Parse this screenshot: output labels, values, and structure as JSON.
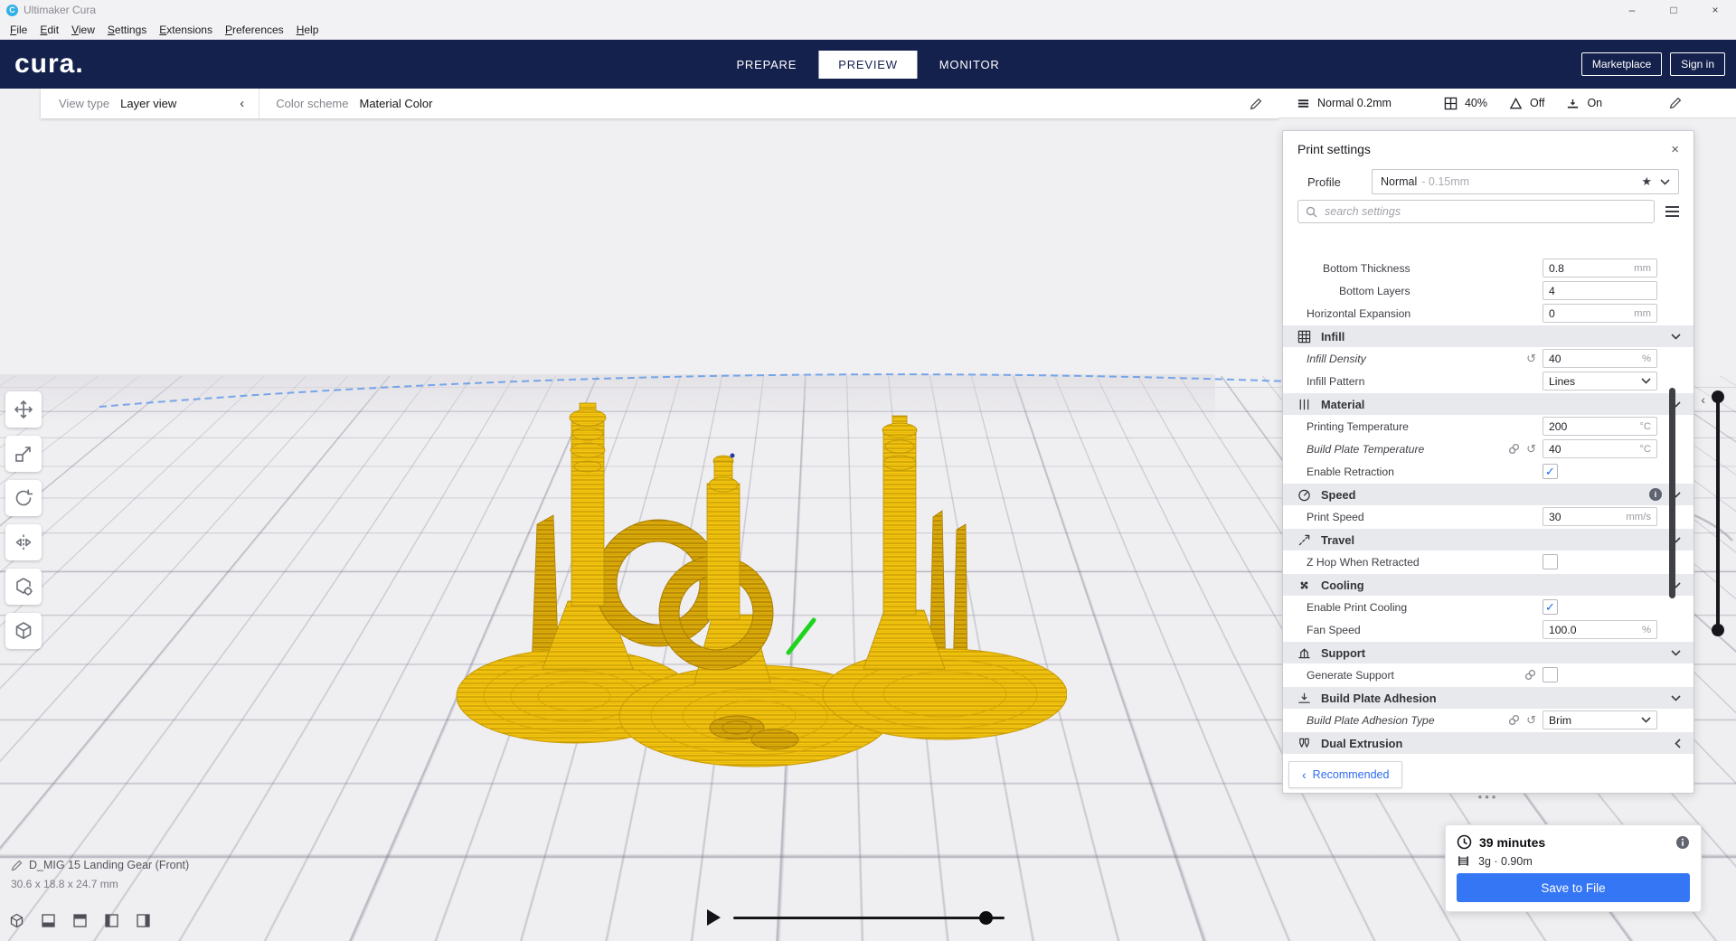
{
  "window": {
    "title": "Ultimaker Cura",
    "menu": [
      "File",
      "Edit",
      "View",
      "Settings",
      "Extensions",
      "Preferences",
      "Help"
    ]
  },
  "header": {
    "logo": "cura.",
    "tabs": [
      {
        "label": "PREPARE",
        "active": false
      },
      {
        "label": "PREVIEW",
        "active": true
      },
      {
        "label": "MONITOR",
        "active": false
      }
    ],
    "marketplace": "Marketplace",
    "sign_in": "Sign in"
  },
  "view_toolbar": {
    "view_type_label": "View type",
    "view_type_value": "Layer view",
    "color_scheme_label": "Color scheme",
    "color_scheme_value": "Material Color"
  },
  "settings_summary": {
    "profile": "Normal 0.2mm",
    "infill": "40%",
    "support": "Off",
    "adhesion": "On"
  },
  "print_settings": {
    "title": "Print settings",
    "profile_label": "Profile",
    "profile_value": "Normal",
    "profile_detail": "- 0.15mm",
    "search_placeholder": "search settings",
    "rows": [
      {
        "type": "setting",
        "label": "Bottom Thickness",
        "value": "0.8",
        "unit": "mm",
        "indent": 1
      },
      {
        "type": "setting",
        "label": "Bottom Layers",
        "value": "4",
        "unit": "",
        "indent": 2
      },
      {
        "type": "setting",
        "label": "Horizontal Expansion",
        "value": "0",
        "unit": "mm",
        "indent": 0
      },
      {
        "type": "category",
        "label": "Infill",
        "icon": "infill-icon"
      },
      {
        "type": "setting",
        "label": "Infill Density",
        "value": "40",
        "unit": "%",
        "italic": true,
        "revert": true
      },
      {
        "type": "select",
        "label": "Infill Pattern",
        "value": "Lines"
      },
      {
        "type": "category",
        "label": "Material",
        "icon": "material-icon"
      },
      {
        "type": "setting",
        "label": "Printing Temperature",
        "value": "200",
        "unit": "°C"
      },
      {
        "type": "setting",
        "label": "Build Plate Temperature",
        "value": "40",
        "unit": "°C",
        "italic": true,
        "link": true,
        "revert": true
      },
      {
        "type": "checkbox",
        "label": "Enable Retraction",
        "checked": true
      },
      {
        "type": "category",
        "label": "Speed",
        "icon": "speed-icon",
        "info": true
      },
      {
        "type": "setting",
        "label": "Print Speed",
        "value": "30",
        "unit": "mm/s"
      },
      {
        "type": "category",
        "label": "Travel",
        "icon": "travel-icon"
      },
      {
        "type": "checkbox",
        "label": "Z Hop When Retracted",
        "checked": false
      },
      {
        "type": "category",
        "label": "Cooling",
        "icon": "cooling-icon"
      },
      {
        "type": "checkbox",
        "label": "Enable Print Cooling",
        "checked": true
      },
      {
        "type": "setting",
        "label": "Fan Speed",
        "value": "100.0",
        "unit": "%"
      },
      {
        "type": "category",
        "label": "Support",
        "icon": "support-icon"
      },
      {
        "type": "checkbox",
        "label": "Generate Support",
        "checked": false,
        "link": true
      },
      {
        "type": "category",
        "label": "Build Plate Adhesion",
        "icon": "adhesion-icon"
      },
      {
        "type": "select",
        "label": "Build Plate Adhesion Type",
        "value": "Brim",
        "italic": true,
        "link": true,
        "revert": true
      },
      {
        "type": "category",
        "label": "Dual Extrusion",
        "icon": "dual-extrusion-icon",
        "collapsed": true
      }
    ],
    "recommended": "Recommended",
    "resize_handle_dots": "•••"
  },
  "output": {
    "time": "39 minutes",
    "material": "3g · 0.90m",
    "save_button": "Save to File"
  },
  "object_info": {
    "name": "D_MIG 15 Landing Gear (Front)",
    "dimensions": "30.6 x 18.8 x 24.7 mm"
  },
  "colors": {
    "accent_blue": "#196ef0",
    "header_navy": "#15214d",
    "save_button_blue": "#3576f5",
    "model_yellow": "#f2c00e",
    "nozzle_green": "#1fd41c"
  }
}
